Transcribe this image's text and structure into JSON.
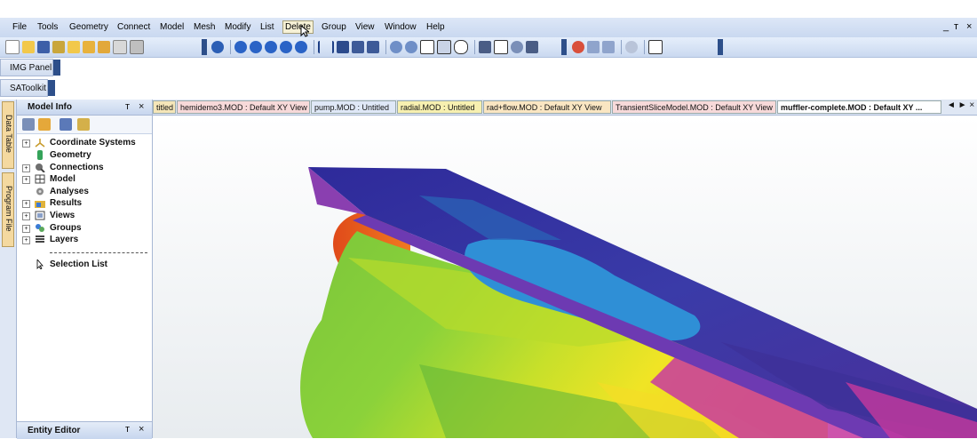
{
  "menu": {
    "items": [
      "File",
      "Tools",
      "Geometry",
      "Connect",
      "Model",
      "Mesh",
      "Modify",
      "List",
      "Delete",
      "Group",
      "View",
      "Window",
      "Help"
    ],
    "active": "Delete",
    "window_controls": [
      "_",
      "т",
      "×"
    ]
  },
  "toolbar_panels": {
    "img_panel": "IMG Panel",
    "satoolkit": "SAToolkit"
  },
  "side_tabs": [
    "Data Table",
    "Program File"
  ],
  "model_info": {
    "title": "Model Info",
    "pin": "т",
    "close": "×",
    "tree": [
      {
        "label": "Coordinate Systems",
        "expander": "+",
        "icon": "axes-icon"
      },
      {
        "label": "Geometry",
        "expander": "",
        "icon": "geometry-icon"
      },
      {
        "label": "Connections",
        "expander": "+",
        "icon": "connections-icon"
      },
      {
        "label": "Model",
        "expander": "+",
        "icon": "model-icon"
      },
      {
        "label": "Analyses",
        "expander": "",
        "icon": "analyses-icon"
      },
      {
        "label": "Results",
        "expander": "+",
        "icon": "results-icon"
      },
      {
        "label": "Views",
        "expander": "+",
        "icon": "views-icon"
      },
      {
        "label": "Groups",
        "expander": "+",
        "icon": "groups-icon"
      },
      {
        "label": "Layers",
        "expander": "+",
        "icon": "layers-icon"
      },
      {
        "label": "Selection List",
        "expander": "",
        "icon": "pointer-icon"
      }
    ]
  },
  "entity_editor": {
    "title": "Entity Editor",
    "pin": "т",
    "close": "×"
  },
  "doc_tabs": [
    {
      "label": "titled",
      "color": "#f5e6b8"
    },
    {
      "label": "hemidemo3.MOD : Default XY View",
      "color": "#f7d9d9"
    },
    {
      "label": "pump.MOD : Untitled",
      "color": "#dfe8f7"
    },
    {
      "label": "radial.MOD : Untitled",
      "color": "#f7f0b0"
    },
    {
      "label": "rad+flow.MOD : Default XY View",
      "color": "#fae6c2"
    },
    {
      "label": "TransientSliceModel.MOD : Default XY View",
      "color": "#f7d9d9"
    },
    {
      "label": "muffler-complete.MOD : Default XY ...",
      "color": "#ffffff"
    }
  ],
  "tab_nav": "◄ ► ×"
}
